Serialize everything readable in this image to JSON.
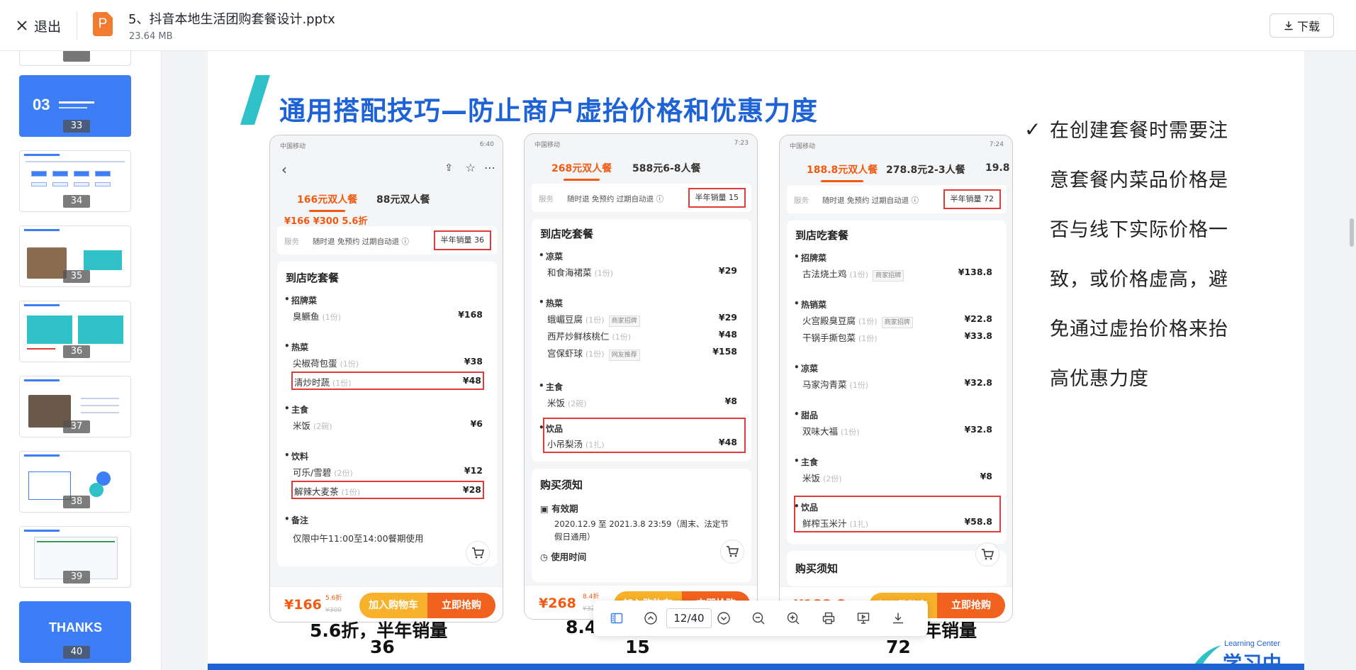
{
  "header": {
    "exit_label": "退出",
    "file_name": "5、抖音本地生活团购套餐设计.pptx",
    "file_size": "23.64 MB",
    "file_type_letter": "P",
    "download_label": "下载"
  },
  "sidebar": {
    "thumbnails": [
      {
        "num": "33",
        "text": "03"
      },
      {
        "num": "34"
      },
      {
        "num": "35"
      },
      {
        "num": "36"
      },
      {
        "num": "37"
      },
      {
        "num": "38"
      },
      {
        "num": "39"
      },
      {
        "num": "40",
        "text": "THANKS"
      }
    ]
  },
  "slide": {
    "title": "通用搭配技巧—防止商户虚抬价格和优惠力度",
    "phones": [
      {
        "status_left": "中国移动",
        "status_time": "6:40",
        "tabs": [
          "166元双人餐",
          "88元双人餐"
        ],
        "price_strip": "¥166 ¥300 5.6折",
        "service_label": "服务",
        "service_tags": "随时退  免预约  过期自动退 ⓘ",
        "sales": "半年销量 36",
        "card_title": "到店吃套餐",
        "categories": [
          {
            "name": "招牌菜",
            "items": [
              {
                "name": "臭鳜鱼",
                "qty": "(1份)",
                "price": "¥168"
              }
            ]
          },
          {
            "name": "热菜",
            "items": [
              {
                "name": "尖椒荷包蛋",
                "qty": "(1份)",
                "price": "¥38"
              },
              {
                "name": "清炒时蔬",
                "qty": "(1份)",
                "price": "¥48"
              }
            ]
          },
          {
            "name": "主食",
            "items": [
              {
                "name": "米饭",
                "qty": "(2碗)",
                "price": "¥6"
              }
            ]
          },
          {
            "name": "饮料",
            "items": [
              {
                "name": "可乐/雪碧",
                "qty": "(2份)",
                "price": "¥12"
              },
              {
                "name": "解辣大麦茶",
                "qty": "(1份)",
                "price": "¥28"
              }
            ]
          },
          {
            "name": "备注",
            "text": "仅限中午11:00至14:00餐期使用"
          }
        ],
        "bottom_price": "¥166",
        "bottom_disc": "5.6折",
        "bottom_orig": "¥300",
        "cart_label": "加入购物车",
        "buy_label": "立即抢购",
        "caption_line1": "5.6折，半年销量",
        "caption_line2": "36"
      },
      {
        "status_left": "中国移动",
        "status_time": "7:23",
        "tabs": [
          "268元双人餐",
          "588元6-8人餐"
        ],
        "service_label": "服务",
        "service_tags": "随时退  免预约  过期自动退 ⓘ",
        "sales": "半年销量 15",
        "card_title": "到店吃套餐",
        "categories": [
          {
            "name": "凉菜",
            "items": [
              {
                "name": "和食海裙菜",
                "qty": "(1份)",
                "price": "¥29"
              }
            ]
          },
          {
            "name": "热菜",
            "items": [
              {
                "name": "蛾嵋豆腐",
                "qty": "(1份)",
                "badge": "商家招牌",
                "price": "¥29"
              },
              {
                "name": "西芹炒鲜核桃仁",
                "qty": "(1份)",
                "price": "¥48"
              },
              {
                "name": "宫保虾球",
                "qty": "(1份)",
                "badge": "网友推荐",
                "price": "¥158"
              }
            ]
          },
          {
            "name": "主食",
            "items": [
              {
                "name": "米饭",
                "qty": "(2碗)",
                "price": "¥8"
              }
            ]
          },
          {
            "name": "饮品",
            "items": [
              {
                "name": "小吊梨汤",
                "qty": "(1扎)",
                "price": "¥48"
              }
            ]
          }
        ],
        "notice_title": "购买须知",
        "validity_label": "有效期",
        "validity_text1": "2020.12.9 至 2021.3.8 23:59（周末、法定节",
        "validity_text2": "假日通用）",
        "usage_label": "使用时间",
        "bottom_price": "¥268",
        "bottom_disc": "8.4折",
        "bottom_orig": "¥32",
        "cart_label": "加入购物车",
        "buy_label": "立即抢购",
        "caption_line1": "8.4",
        "caption_line2": "15"
      },
      {
        "status_left": "中国移动",
        "status_time": "7:24",
        "tabs": [
          "188.8元双人餐",
          "278.8元2-3人餐",
          "19.8"
        ],
        "service_label": "服务",
        "service_tags": "随时退  免预约  过期自动退 ⓘ",
        "sales": "半年销量 72",
        "card_title": "到店吃套餐",
        "categories": [
          {
            "name": "招牌菜",
            "items": [
              {
                "name": "古法烧土鸡",
                "qty": "(1份)",
                "badge": "商家招牌",
                "price": "¥138.8"
              }
            ]
          },
          {
            "name": "热销菜",
            "items": [
              {
                "name": "火宫殿臭豆腐",
                "qty": "(1份)",
                "badge": "商家招牌",
                "price": "¥22.8"
              },
              {
                "name": "干锅手撕包菜",
                "qty": "(1份)",
                "price": "¥33.8"
              }
            ]
          },
          {
            "name": "凉菜",
            "items": [
              {
                "name": "马家沟青菜",
                "qty": "(1份)",
                "price": "¥32.8"
              }
            ]
          },
          {
            "name": "甜品",
            "items": [
              {
                "name": "双味大福",
                "qty": "(1份)",
                "price": "¥32.8"
              }
            ]
          },
          {
            "name": "主食",
            "items": [
              {
                "name": "米饭",
                "qty": "(2份)",
                "price": "¥8"
              }
            ]
          },
          {
            "name": "饮品",
            "items": [
              {
                "name": "鲜榨玉米汁",
                "qty": "(1扎)",
                "price": "¥58.8"
              }
            ]
          }
        ],
        "notice_title": "购买须知",
        "bottom_price": "¥188.8",
        "cart_label": "加入购物车",
        "buy_label": "立即抢购",
        "caption_line1": "年销量",
        "caption_line2": "72"
      }
    ],
    "notes": [
      "在创建套餐时需要注",
      "意套餐内菜品价格是",
      "否与线下实际价格一",
      "致，或价格虚高，避",
      "免通过虚抬价格来抬",
      "高优惠力度"
    ],
    "logo_en": "Learning Center",
    "logo_cn": "学习中心"
  },
  "toolbar": {
    "page_indicator": "12/40"
  },
  "colors": {
    "accent": "#3d7ef7",
    "title_blue": "#1e63d6",
    "highlight_red": "#e03a3a",
    "douyin_orange": "#f25a12"
  }
}
